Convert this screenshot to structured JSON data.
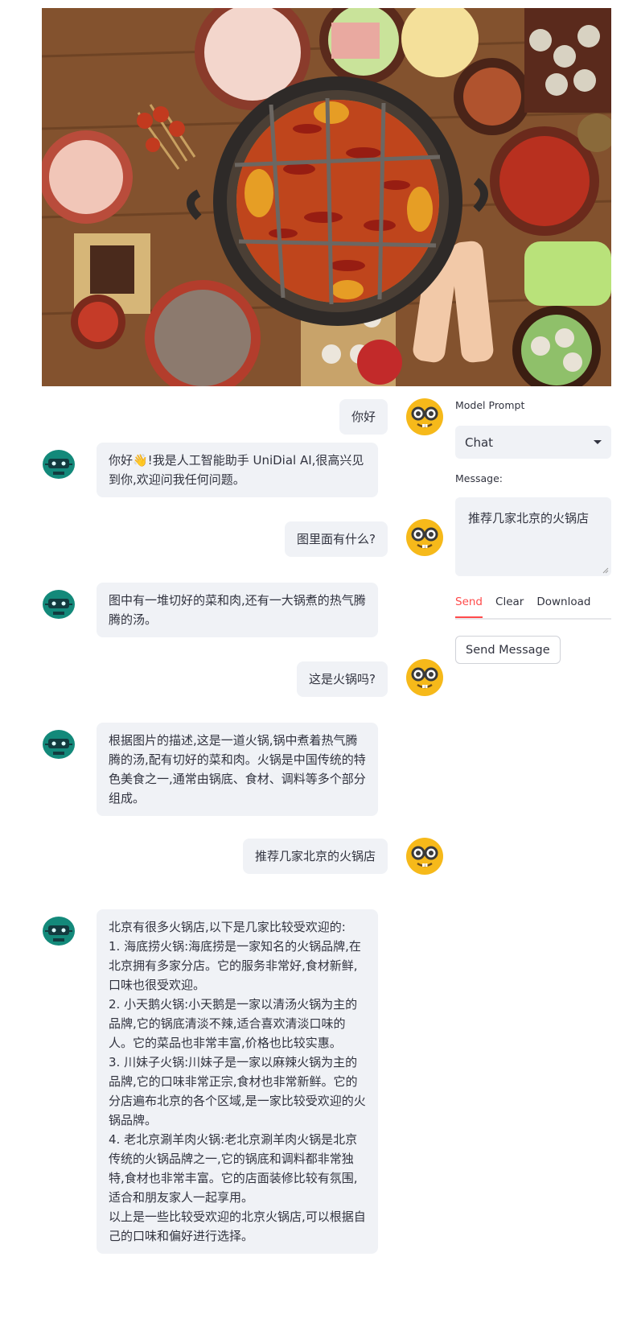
{
  "chat": {
    "messages": [
      {
        "role": "user",
        "text": "你好"
      },
      {
        "role": "assistant",
        "text": "你好👋!我是人工智能助手 UniDial AI,很高兴见到你,欢迎问我任何问题。"
      },
      {
        "role": "user",
        "text": "图里面有什么?"
      },
      {
        "role": "assistant",
        "text": "图中有一堆切好的菜和肉,还有一大锅煮的热气腾腾的汤。"
      },
      {
        "role": "user",
        "text": "这是火锅吗?"
      },
      {
        "role": "assistant",
        "text": "根据图片的描述,这是一道火锅,锅中煮着热气腾腾的汤,配有切好的菜和肉。火锅是中国传统的特色美食之一,通常由锅底、食材、调料等多个部分组成。"
      },
      {
        "role": "user",
        "text": "推荐几家北京的火锅店"
      },
      {
        "role": "assistant",
        "text": "北京有很多火锅店,以下是几家比较受欢迎的:\n1. 海底捞火锅:海底捞是一家知名的火锅品牌,在北京拥有多家分店。它的服务非常好,食材新鲜,口味也很受欢迎。\n2. 小天鹅火锅:小天鹅是一家以清汤火锅为主的品牌,它的锅底清淡不辣,适合喜欢清淡口味的人。它的菜品也非常丰富,价格也比较实惠。\n3. 川妹子火锅:川妹子是一家以麻辣火锅为主的品牌,它的口味非常正宗,食材也非常新鲜。它的分店遍布北京的各个区域,是一家比较受欢迎的火锅品牌。\n4. 老北京涮羊肉火锅:老北京涮羊肉火锅是北京传统的火锅品牌之一,它的锅底和调料都非常独特,食材也非常丰富。它的店面装修比较有氛围,适合和朋友家人一起享用。\n以上是一些比较受欢迎的北京火锅店,可以根据自己的口味和偏好进行选择。"
      }
    ]
  },
  "panel": {
    "model_prompt_label": "Model Prompt",
    "model_prompt_value": "Chat",
    "message_label": "Message:",
    "message_value": "推荐几家北京的火锅店",
    "tabs": [
      "Send",
      "Clear",
      "Download"
    ],
    "active_tab": "Send",
    "send_button": "Send Message"
  },
  "colors": {
    "accent": "#ff4b4b",
    "bubble": "#f0f2f6",
    "text": "#31333f",
    "user_avatar": "#f6b91a",
    "bot_avatar": "#13897a"
  }
}
